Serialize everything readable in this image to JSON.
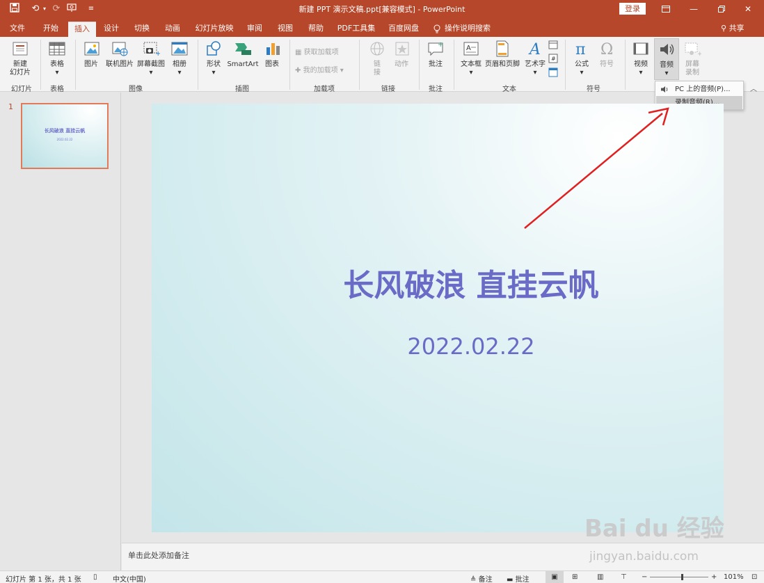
{
  "window": {
    "title": "新建 PPT 演示文稿.ppt[兼容模式] - PowerPoint",
    "login_label": "登录"
  },
  "menu": {
    "tabs": [
      "文件",
      "开始",
      "插入",
      "设计",
      "切换",
      "动画",
      "幻灯片放映",
      "审阅",
      "视图",
      "帮助",
      "PDF工具集",
      "百度网盘"
    ],
    "active_tab": "插入",
    "search_label": "操作说明搜索",
    "share_label": "共享"
  },
  "ribbon": {
    "new_slide": "新建\n幻灯片",
    "table": "表格",
    "picture": "图片",
    "online_picture": "联机图片",
    "screenshot": "屏幕截图",
    "album": "相册",
    "shapes": "形状",
    "smartart": "SmartArt",
    "chart": "图表",
    "get_addins": "获取加载项",
    "my_addins": "我的加载项",
    "link": "链\n接",
    "action": "动作",
    "comment": "批注",
    "textbox": "文本框",
    "header_footer": "页眉和页脚",
    "wordart": "艺术字",
    "equation": "公式",
    "symbol": "符号",
    "video": "视频",
    "audio": "音频",
    "screen_record": "屏幕\n录制",
    "groups": {
      "slides": "幻灯片",
      "tables": "表格",
      "images": "图像",
      "illustrations": "插图",
      "addins": "加载项",
      "links": "链接",
      "comments": "批注",
      "text": "文本",
      "symbols": "符号"
    }
  },
  "audio_menu": {
    "items": [
      "PC 上的音频(P)...",
      "录制音频(R)..."
    ],
    "highlighted": "录制音频(R)..."
  },
  "thumbnails": [
    {
      "number": "1",
      "title": "长风破浪 直挂云帆",
      "date": "2022.02.22"
    }
  ],
  "slide": {
    "title": "长风破浪 直挂云帆",
    "date": "2022.02.22"
  },
  "notes": {
    "placeholder": "单击此处添加备注"
  },
  "status": {
    "slide_info": "幻灯片 第 1 张，共 1 张",
    "language": "中文(中国)",
    "notes_label": "备注",
    "comments_label": "批注",
    "zoom": "101%",
    "zoom_fraction": 0.55
  },
  "watermark": {
    "brand": "Bai du 经验",
    "url": "jingyan.baidu.com"
  },
  "colors": {
    "accent": "#b7472a",
    "slide_text": "#6a6bc6",
    "arrow": "#e02020"
  }
}
